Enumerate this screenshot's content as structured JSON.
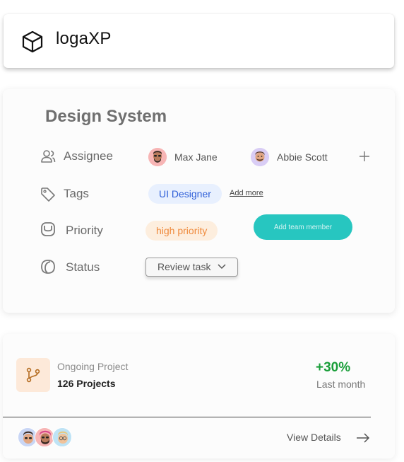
{
  "brand": {
    "name": "logaXP",
    "icon": "cube-icon"
  },
  "task": {
    "title": "Design System",
    "fields": {
      "assignee_label": "Assignee",
      "tags_label": "Tags",
      "priority_label": "Priority",
      "status_label": "Status"
    },
    "assignees": [
      {
        "name": "Max Jane",
        "avatar_bg": "#f7b5b5"
      },
      {
        "name": "Abbie Scott",
        "avatar_bg": "#d9cdf5"
      }
    ],
    "add_assignee_icon": "plus-icon",
    "tags": [
      "UI Designer"
    ],
    "add_more_label": "Add more",
    "priority": "high priority",
    "add_team_member_label": "Add team member",
    "status_value": "Review task",
    "colors": {
      "tag_bg": "#e8f0fe",
      "tag_text": "#2f5fd8",
      "priority_bg": "#fdeede",
      "priority_text": "#ef8a3c",
      "accent": "#27c6c0"
    }
  },
  "project": {
    "label": "Ongoing Project",
    "count": "126 Projects",
    "growth": "+30%",
    "growth_period": "Last month",
    "view_details_label": "View Details",
    "colors": {
      "icon_bg": "#fde9d9",
      "growth": "#1a9e3a"
    }
  }
}
